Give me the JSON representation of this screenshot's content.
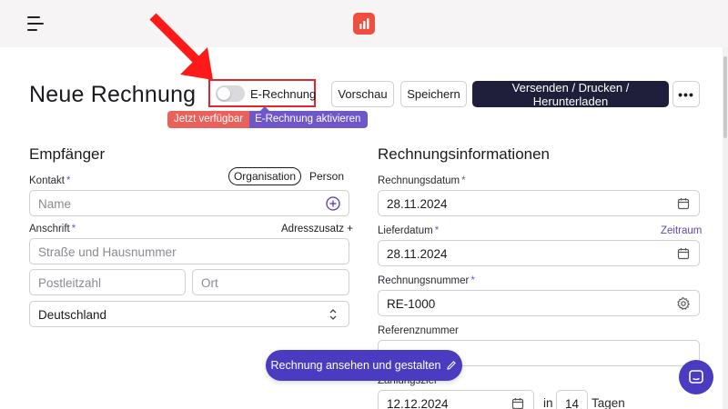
{
  "header": {
    "menu_icon": "hamburger-icon",
    "logo_icon": "bar-chart-logo-icon",
    "logo_color": "#f04e3e"
  },
  "page": {
    "title": "Neue Rechnung"
  },
  "erechnung": {
    "toggle_label": "E-Rechnung",
    "enabled": false,
    "badge_new": "Jetzt verfügbar",
    "badge_activate": "E-Rechnung aktivieren"
  },
  "toolbar": {
    "preview": "Vorschau",
    "save": "Speichern",
    "send": "Versenden / Drucken / Herunterladen",
    "more": "•••"
  },
  "recipient": {
    "title": "Empfänger",
    "contact_label": "Kontakt",
    "type_options": [
      "Organisation",
      "Person"
    ],
    "type_selected": "Organisation",
    "name_placeholder": "Name",
    "address_label": "Anschrift",
    "address_extra": "Adresszusatz +",
    "street_placeholder": "Straße und Hausnummer",
    "zip_placeholder": "Postleitzahl",
    "city_placeholder": "Ort",
    "country": "Deutschland"
  },
  "invoice_info": {
    "title": "Rechnungsinformationen",
    "invoice_date_label": "Rechnungsdatum",
    "invoice_date": "28.11.2024",
    "delivery_date_label": "Lieferdatum",
    "delivery_range_link": "Zeitraum",
    "delivery_date": "28.11.2024",
    "invoice_number_label": "Rechnungsnummer",
    "invoice_number": "RE-1000",
    "reference_label": "Referenznummer",
    "reference_value": "",
    "payment_label": "Zahlungsziel",
    "due_date": "12.12.2024",
    "in_label": "in",
    "days": "14",
    "days_label": "Tagen"
  },
  "fab": {
    "label": "Rechnung ansehen und gestalten",
    "icon": "pencil-icon"
  },
  "chat": {
    "icon": "chat-icon"
  },
  "colors": {
    "primary_dark": "#1f1f3b",
    "accent_purple": "#6f56c9",
    "fab": "#4a3bc0",
    "badge_red": "#e8615b",
    "highlight_red": "#e5242b"
  }
}
